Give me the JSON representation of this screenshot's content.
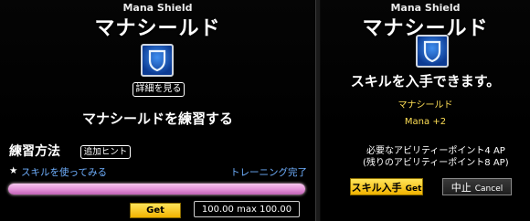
{
  "left": {
    "title_en": "Mana Shield",
    "title_jp": "マナシールド",
    "icon": "shield-icon",
    "details_button": "詳細を見る",
    "practice_heading": "マナシールドを練習する",
    "method_label": "練習方法",
    "hint_button": "追加ヒント",
    "task_bullet": "★",
    "task_text": "スキルを使ってみる",
    "task_status": "トレーニング完了",
    "progress": 1.0,
    "get_button": "Get",
    "training_value": "100.00",
    "training_sep": "max",
    "training_max": "100.00"
  },
  "right": {
    "title_en": "Mana Shield",
    "title_jp": "マナシールド",
    "icon": "shield-icon",
    "message": "スキルを入手できます。",
    "skill_name": "マナシールド",
    "skill_bonus": "Mana +2",
    "required_ap": "必要なアビリティーポイント4 AP",
    "remaining_ap": "(残りのアビリティーポイント8 AP)",
    "acquire_label": "スキル入手",
    "acquire_sub": "Get",
    "cancel_label": "中止",
    "cancel_sub": "Cancel"
  },
  "colors": {
    "accent_yellow": "#ffdf55",
    "link_blue": "#6fb0ff",
    "progress_pink": "#e391d8",
    "button_gold": "#f1b300"
  }
}
